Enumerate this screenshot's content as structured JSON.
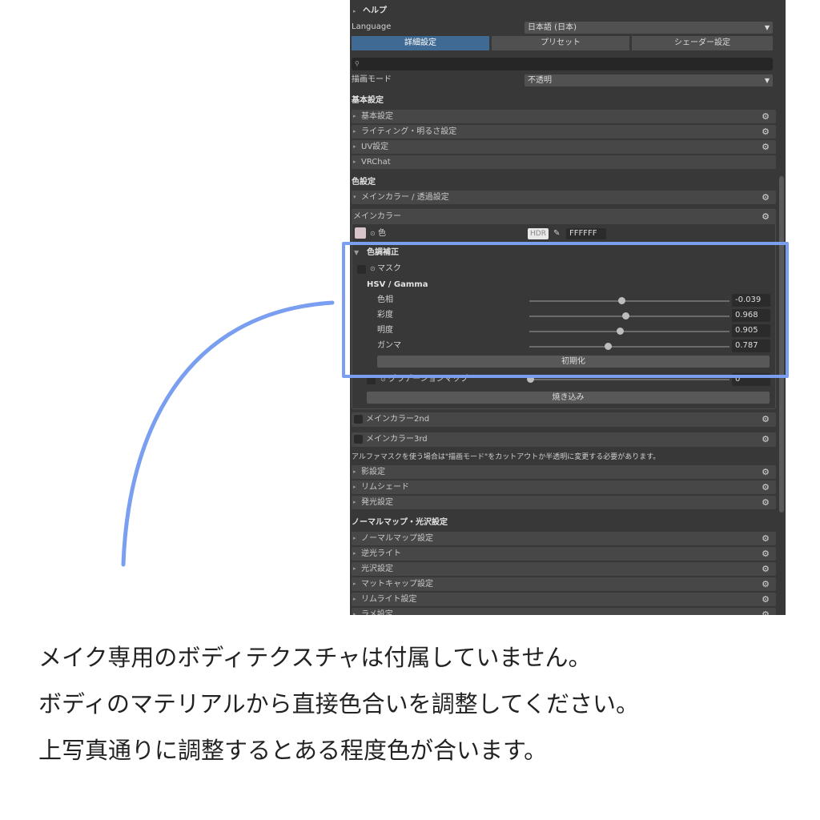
{
  "help": "ヘルプ",
  "language": {
    "label": "Language",
    "value": "日本語 (日本)"
  },
  "tabs": [
    "詳細設定",
    "プリセット",
    "シェーダー設定"
  ],
  "render_mode": {
    "label": "描画モード",
    "value": "不透明"
  },
  "basic_section": "基本設定",
  "basic_rows": [
    "基本設定",
    "ライティング・明るさ設定",
    "UV設定",
    "VRChat"
  ],
  "color_section": "色設定",
  "main_color_transparency": "メインカラー / 透過設定",
  "main_color_box": {
    "title": "メインカラー",
    "color_label": "色",
    "hdr": "HDR",
    "hex": "FFFFFF",
    "color_correction": "色調補正",
    "mask": "マスク",
    "hsv_title": "HSV / Gamma",
    "sliders": [
      {
        "label": "色相",
        "value": "-0.039",
        "level": 0.46
      },
      {
        "label": "彩度",
        "value": "0.968",
        "level": 0.48
      },
      {
        "label": "明度",
        "value": "0.905",
        "level": 0.45
      },
      {
        "label": "ガンマ",
        "value": "0.787",
        "level": 0.39
      }
    ],
    "reset": "初期化",
    "gradation_map": "グラデーションマップ",
    "gradation_value": "0",
    "bake": "焼き込み"
  },
  "main_color_2nd": "メインカラー2nd",
  "main_color_3rd": "メインカラー3rd",
  "alpha_note": "アルファマスクを使う場合は\"描画モード\"をカットアウトか半透明に変更する必要があります。",
  "color_rows": [
    "影設定",
    "リムシェード",
    "発光設定"
  ],
  "normal_section": "ノーマルマップ・光沢設定",
  "normal_rows": [
    "ノーマルマップ設定",
    "逆光ライト",
    "光沢設定",
    "マットキャップ設定",
    "リムライト設定",
    "ラメ設定"
  ],
  "captions": [
    "メイク専用のボディテクスチャは付属していません。",
    "ボディのマテリアルから直接色合いを調整してください。",
    "上写真通りに調整するとある程度色が合います。"
  ],
  "colors": {
    "highlight": "#7b9ff0",
    "panel_bg": "#383838"
  }
}
